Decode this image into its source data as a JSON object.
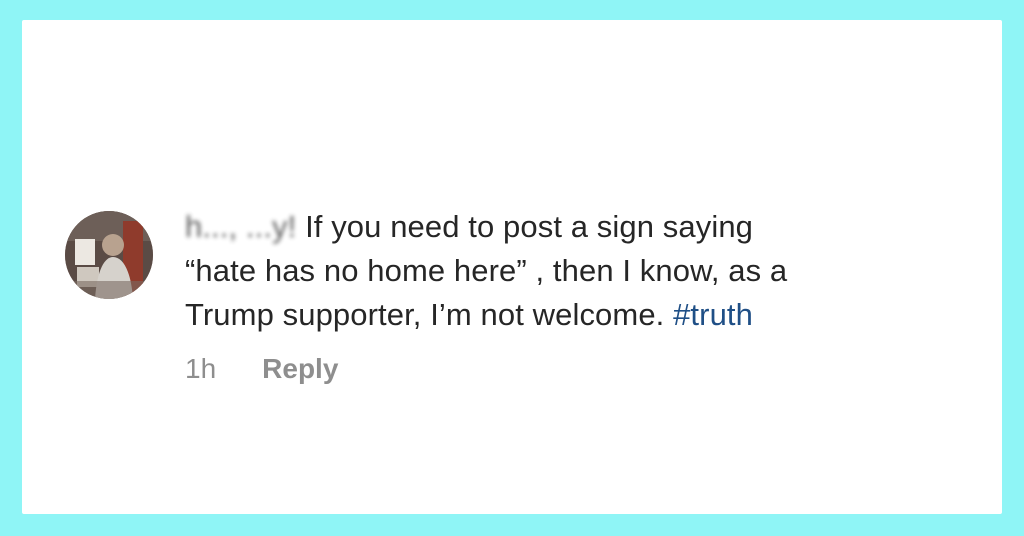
{
  "comment": {
    "username": "h..., ...y!",
    "text_line_1": " If you need to post a sign saying",
    "text_line_2": "“hate has no home here” , then I know, as a",
    "text_line_3": "Trump supporter, I’m not welcome. ",
    "hashtag": "#truth",
    "timestamp": "1h",
    "reply_label": "Reply"
  },
  "colors": {
    "border": "#8ff5f6",
    "hashtag": "#1f4f86",
    "text": "#262626",
    "meta": "#8e8e8e"
  }
}
